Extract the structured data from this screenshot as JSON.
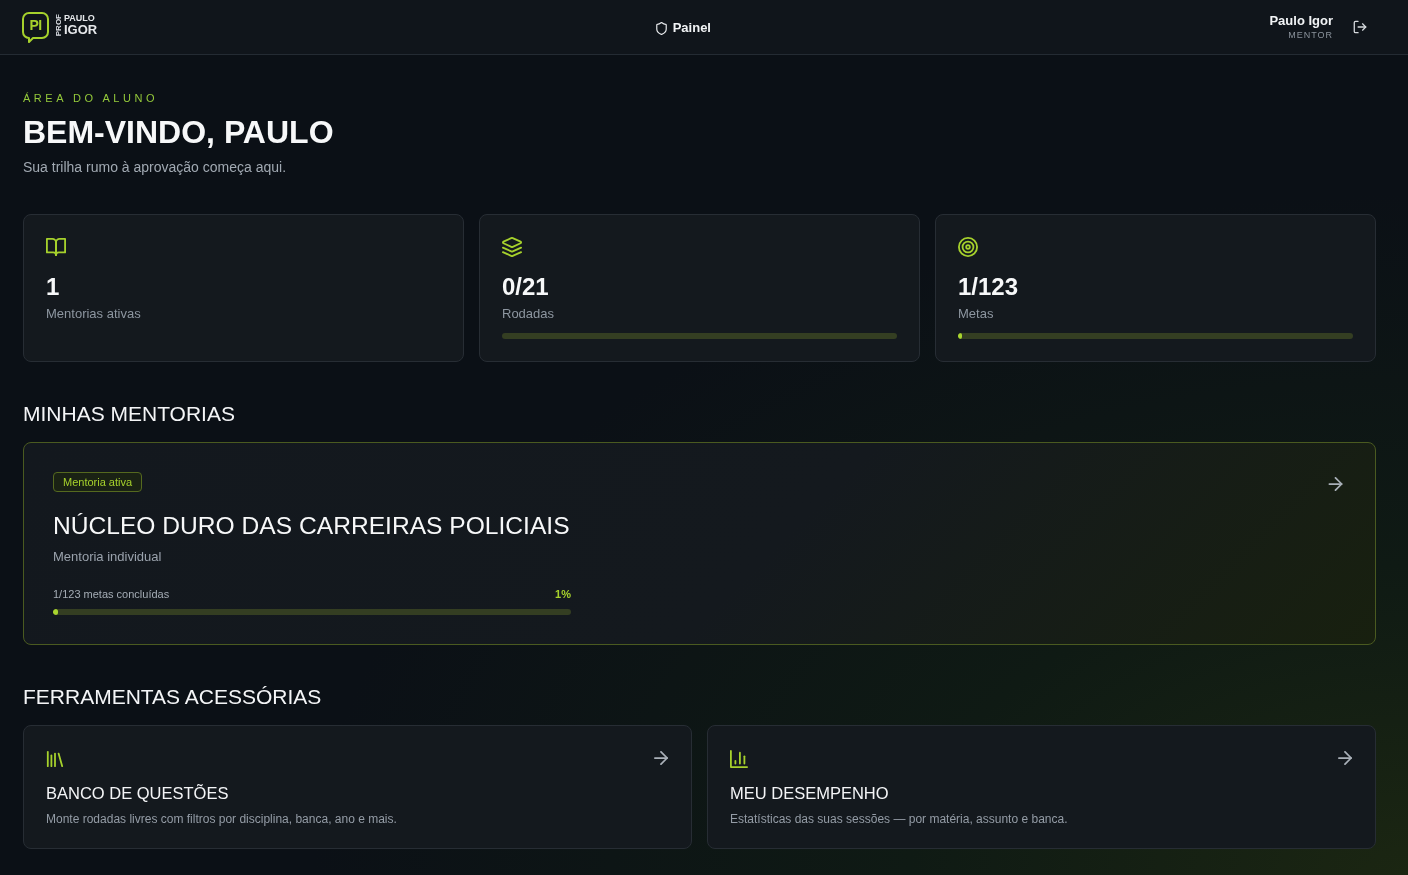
{
  "header": {
    "logo": {
      "mark": "PI",
      "prefix": "PROF",
      "first_name": "PAULO",
      "last_name": "IGOR"
    },
    "nav": [
      {
        "label": "Painel"
      }
    ],
    "user": {
      "name": "Paulo Igor",
      "role": "MENTOR"
    }
  },
  "hero": {
    "eyebrow": "ÁREA DO ALUNO",
    "title": "BEM-VINDO, PAULO",
    "subtitle": "Sua trilha rumo à aprovação começa aqui."
  },
  "stats": [
    {
      "kind": "count",
      "value": "1",
      "label": "Mentorias ativas"
    },
    {
      "kind": "progress",
      "value": "0/21",
      "label": "Rodadas",
      "level": 0
    },
    {
      "kind": "progress",
      "value": "1/123",
      "label": "Metas",
      "level": 0.01
    }
  ],
  "mentorships": {
    "title": "MINHAS MENTORIAS",
    "items": [
      {
        "badge": "Mentoria ativa",
        "title": "NÚCLEO DURO DAS CARREIRAS POLICIAIS",
        "type": "Mentoria individual",
        "progress_label": "1/123 metas concluídas",
        "percent": "1%",
        "level": 0.01
      }
    ]
  },
  "tools": {
    "title": "FERRAMENTAS ACESSÓRIAS",
    "items": [
      {
        "title": "BANCO DE QUESTÕES",
        "description": "Monte rodadas livres com filtros por disciplina, banca, ano e mais."
      },
      {
        "title": "MEU DESEMPENHO",
        "description": "Estatísticas das suas sessões — por matéria, assunto e banca."
      }
    ]
  }
}
